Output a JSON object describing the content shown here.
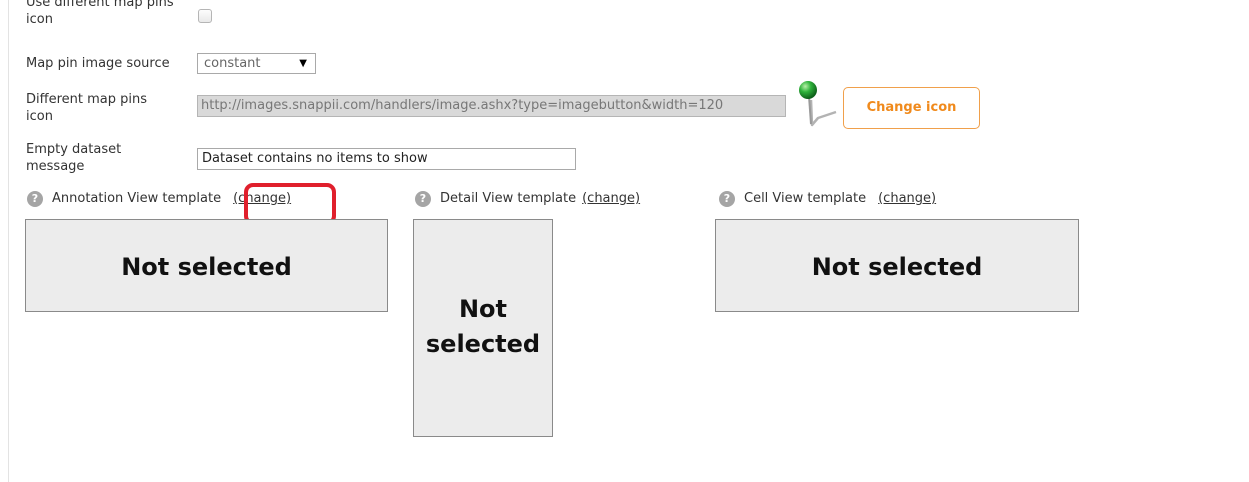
{
  "form": {
    "different_pins_label": "Use different map pins icon",
    "pin_source_label": "Map pin image source",
    "pin_source_value": "constant",
    "pins_icon_label": "Different map pins icon",
    "pins_icon_url": "http://images.snappii.com/handlers/image.ashx?type=imagebutton&width=120",
    "change_icon_button": "Change icon",
    "empty_message_label": "Empty dataset message",
    "empty_message_value": "Dataset contains no items to show"
  },
  "templates": [
    {
      "label": "Annotation View template",
      "change": "(change)",
      "box_text": "Not selected"
    },
    {
      "label": "Detail View template",
      "change": "(change)",
      "box_text": "Not selected"
    },
    {
      "label": "Cell View template",
      "change": "(change)",
      "box_text": "Not selected"
    }
  ],
  "icons": {
    "help": "?",
    "dropdown": "▼",
    "pin": "map-pin-icon"
  },
  "colors": {
    "accent_orange": "#f08a1c",
    "highlight_red": "#e01f2c",
    "pin_green": "#1f9a2d"
  }
}
